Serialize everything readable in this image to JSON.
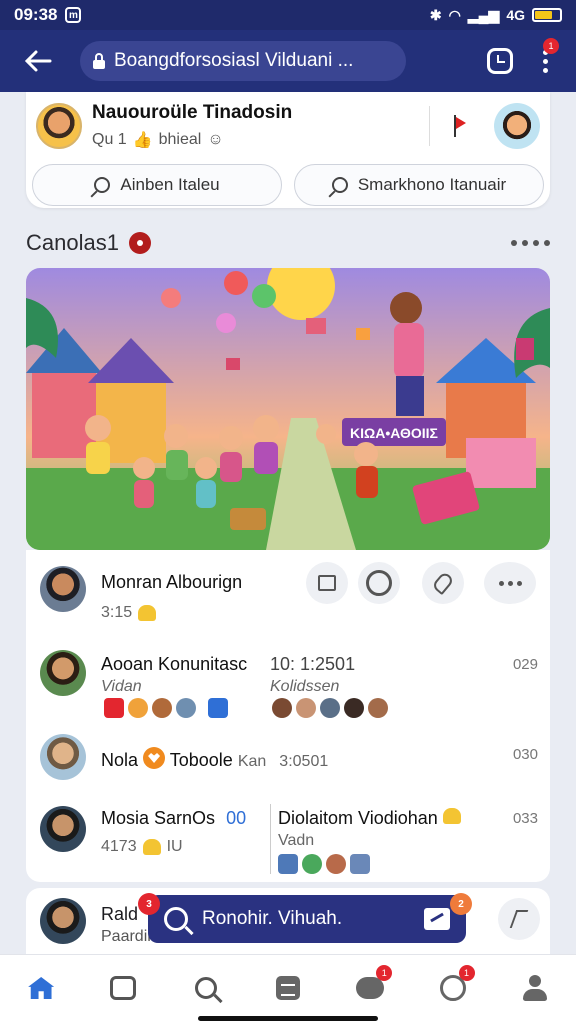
{
  "status": {
    "time": "09:38",
    "icon_badge": "ⓜ",
    "right_text": "4G"
  },
  "appbar": {
    "address": "Boangdforsosiasl Vilduani ...",
    "notif_badge": "1"
  },
  "profile": {
    "name": "Nauouroüle Tinadosin",
    "meta": "Qu 1",
    "meta2": "bhieal",
    "pill_left": "Ainben Italeu",
    "pill_right": "Smarkhono Itanuair"
  },
  "section": {
    "title": "Canolas1"
  },
  "feed": {
    "row1": {
      "name": "Monran Albourign",
      "sub": "3:15"
    },
    "row2": {
      "name": "Aooan Konunitasc",
      "time": "10: 1:2501",
      "count": "029",
      "sub": "Vidan",
      "sub2": "Kolidssen"
    },
    "row3": {
      "name": "Nola",
      "name2": "Toboole",
      "tail": "Kan",
      "time": "3:0501",
      "count": "030"
    },
    "row4": {
      "name": "Mosia SarnOs",
      "mark": "00",
      "right_name": "Diolaitom Viodiohan",
      "sub": "4173",
      "sub_tail": "IU",
      "right_sub": "Vadn",
      "count": "033"
    }
  },
  "strip": {
    "name": "Rald",
    "sub": "Paardir"
  },
  "snack": {
    "text": "Ronohir. Vihuah.",
    "badge_left": "3",
    "badge_right": "2"
  },
  "nav": {
    "badge_chat": "1",
    "badge_compass": "1"
  }
}
